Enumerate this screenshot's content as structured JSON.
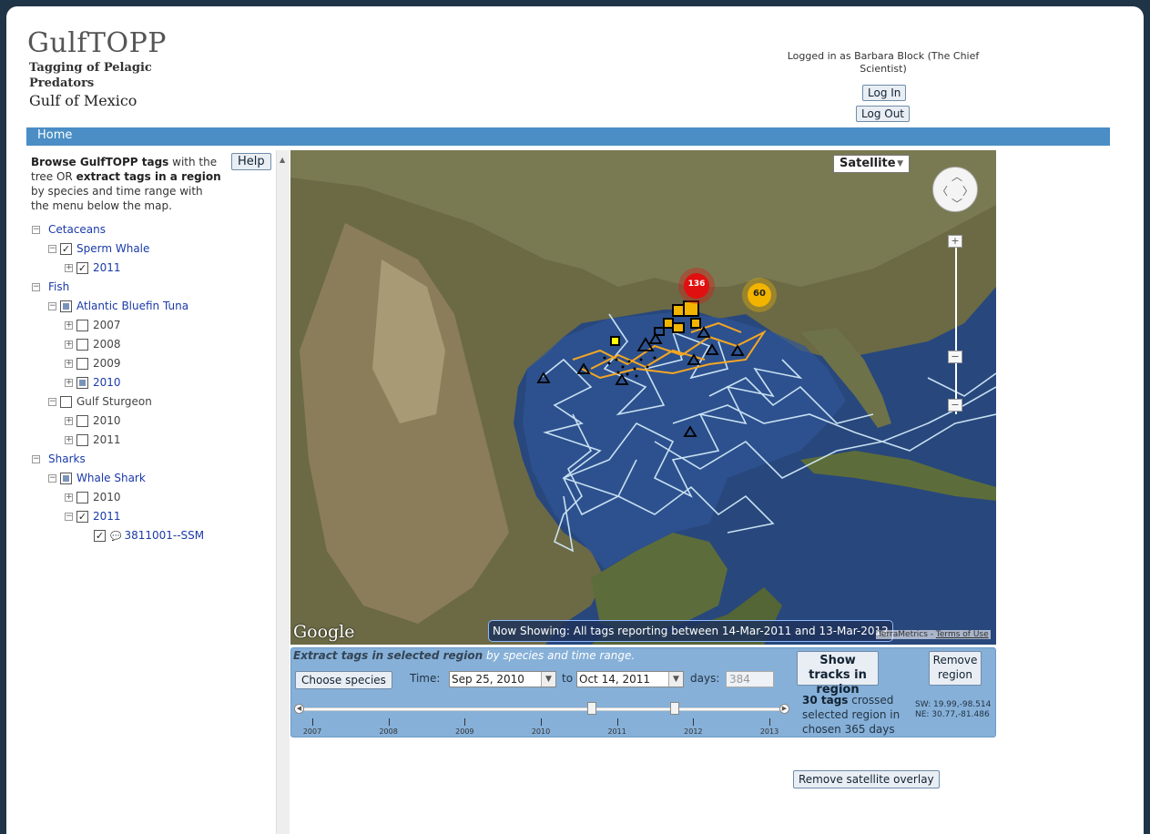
{
  "header": {
    "logo_title": "GulfTOPP",
    "logo_sub_line1": "Tagging of Pelagic",
    "logo_sub_line2": "Predators",
    "logo_region": "Gulf of Mexico",
    "login_status": "Logged in as Barbara Block (The Chief Scientist)",
    "login_label": "Log In",
    "logout_label": "Log Out"
  },
  "nav": {
    "home_label": "Home"
  },
  "sidebar": {
    "intro_bold1": "Browse GulfTOPP tags",
    "intro_text1": " with the tree OR ",
    "intro_bold2": "extract tags in a region",
    "intro_text2": " by species and time range with the menu below the map.",
    "help_label": "Help",
    "tree": [
      {
        "label": "Cetaceans",
        "level": 0,
        "expander": "−",
        "checkbox": "none",
        "style": "link"
      },
      {
        "label": "Sperm Whale",
        "level": 1,
        "expander": "−",
        "checkbox": "checked",
        "style": "link"
      },
      {
        "label": "2011",
        "level": 2,
        "expander": "+",
        "checkbox": "checked",
        "style": "link"
      },
      {
        "label": "Fish",
        "level": 0,
        "expander": "−",
        "checkbox": "none",
        "style": "link"
      },
      {
        "label": "Atlantic Bluefin Tuna",
        "level": 1,
        "expander": "−",
        "checkbox": "partial",
        "style": "link"
      },
      {
        "label": "2007",
        "level": 2,
        "expander": "+",
        "checkbox": "empty",
        "style": "plain"
      },
      {
        "label": "2008",
        "level": 2,
        "expander": "+",
        "checkbox": "empty",
        "style": "plain"
      },
      {
        "label": "2009",
        "level": 2,
        "expander": "+",
        "checkbox": "empty",
        "style": "plain"
      },
      {
        "label": "2010",
        "level": 2,
        "expander": "+",
        "checkbox": "partial",
        "style": "link"
      },
      {
        "label": "Gulf Sturgeon",
        "level": 1,
        "expander": "−",
        "checkbox": "empty",
        "style": "plain"
      },
      {
        "label": "2010",
        "level": 2,
        "expander": "+",
        "checkbox": "empty",
        "style": "plain"
      },
      {
        "label": "2011",
        "level": 2,
        "expander": "+",
        "checkbox": "empty",
        "style": "plain"
      },
      {
        "label": "Sharks",
        "level": 0,
        "expander": "−",
        "checkbox": "none",
        "style": "link"
      },
      {
        "label": "Whale Shark",
        "level": 1,
        "expander": "−",
        "checkbox": "partial",
        "style": "link"
      },
      {
        "label": "2010",
        "level": 2,
        "expander": "+",
        "checkbox": "empty",
        "style": "plain"
      },
      {
        "label": "2011",
        "level": 2,
        "expander": "−",
        "checkbox": "checked",
        "style": "link"
      },
      {
        "label": "3811001--SSM",
        "level": 3,
        "expander": "",
        "checkbox": "checked",
        "style": "link",
        "icon": "speech-bubble-icon"
      }
    ]
  },
  "map": {
    "map_type": "Satellite",
    "cluster_red": "136",
    "cluster_yellow": "60",
    "google_label": "Google",
    "now_showing": "Now Showing: All tags reporting between 14-Mar-2011 and 13-Mar-2012",
    "attribution": "TerraMetrics",
    "terms_label": "Terms of Use",
    "colors": {
      "ocean": "#2c4e85",
      "land": "#5a6a3c",
      "track": "#d8f0ff",
      "region": "#f5a623",
      "cluster_red": "#e01010",
      "cluster_yellow": "#f3b400"
    }
  },
  "extract": {
    "title_bold": "Extract tags in selected region",
    "title_rest": " by species and time range.",
    "choose_label": "Choose species",
    "time_label": "Time:",
    "start_date": "Sep 25, 2010",
    "to_label": "to",
    "end_date": "Oct 14, 2011",
    "days_label": "days:",
    "days_value": "384",
    "slider_years": [
      "2007",
      "2008",
      "2009",
      "2010",
      "2011",
      "2012",
      "2013"
    ],
    "show_tracks_label": "Show tracks in region",
    "remove_region_label": "Remove region",
    "tags_count": "30 tags",
    "tags_text": " crossed selected region in chosen 365 days",
    "sw": "SW: 19.99,-98.514",
    "ne": "NE: 30.77,-81.486"
  },
  "remove_overlay_label": "Remove satellite overlay"
}
